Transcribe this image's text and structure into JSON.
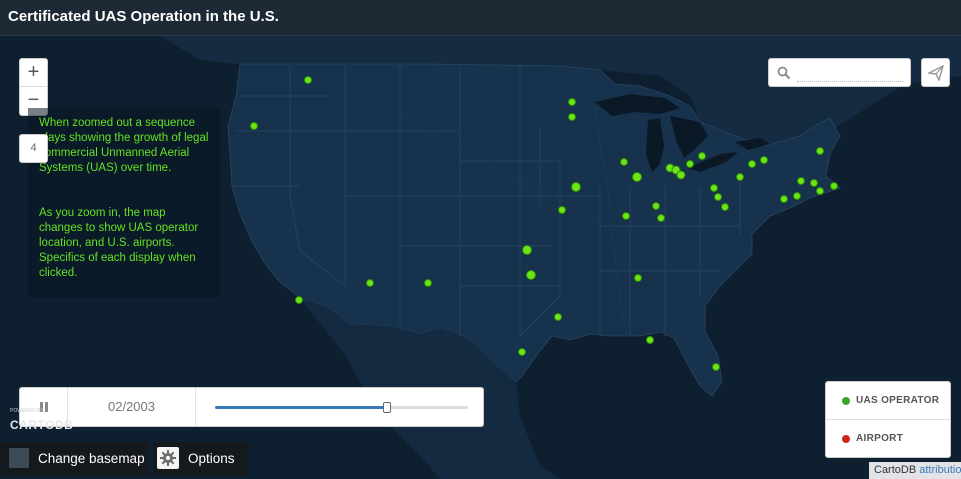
{
  "header": {
    "title": "Certificated UAS Operation in the U.S."
  },
  "map": {
    "zoom_level": "4",
    "zoom_in_label": "+",
    "zoom_out_label": "−",
    "point_color": "#6be614",
    "land_color": "#15304a",
    "water_color": "#0e1f30"
  },
  "description": {
    "paragraph1": "When zoomed out a sequence plays showing the growth of legal commercial Unmanned Aerial Systems (UAS) over time.",
    "paragraph2": "As you zoom in, the map changes to show UAS operator location, and U.S. airports. Specifics of each display when clicked.",
    "text_color": "#64e21f"
  },
  "search": {
    "placeholder": "",
    "value": "",
    "icon": "search-icon"
  },
  "share": {
    "icon": "share-icon"
  },
  "timeline": {
    "state_icon": "pause-icon",
    "date": "02/2003",
    "progress": 0.68
  },
  "branding": {
    "powered_by": "POWERED BY",
    "logo": "CARTODB"
  },
  "buttons": {
    "basemap": "Change basemap",
    "options": "Options"
  },
  "legend": {
    "items": [
      {
        "label": "UAS OPERATOR",
        "color": "#3ea32a"
      },
      {
        "label": "AIRPORT",
        "color": "#d0251d"
      }
    ]
  },
  "attribution": {
    "provider": "CartoDB",
    "link": "attribution"
  }
}
